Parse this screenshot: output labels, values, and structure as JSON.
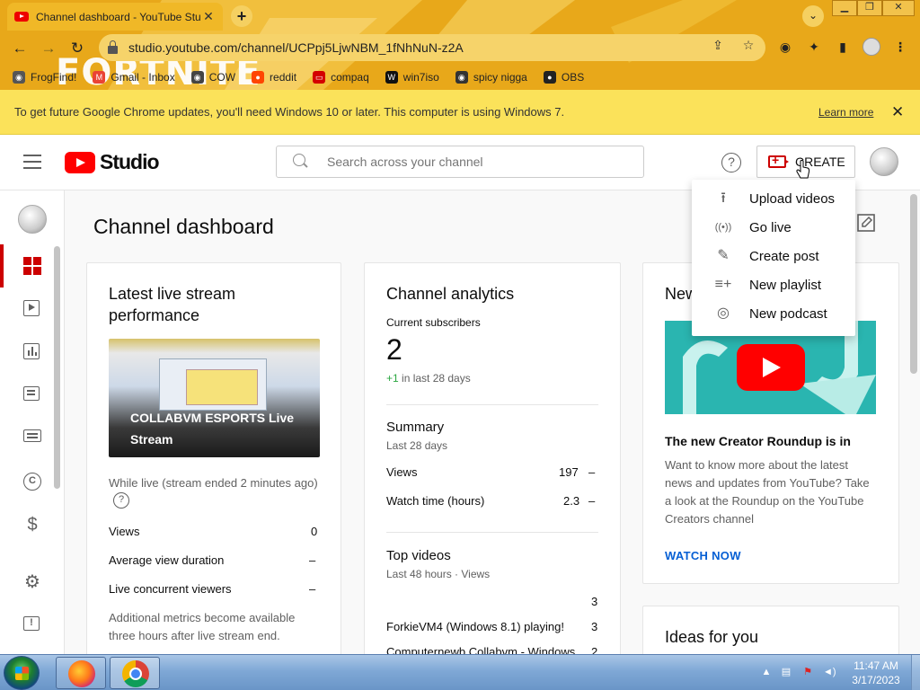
{
  "browser": {
    "tab_title": "Channel dashboard - YouTube Studio",
    "tab_close": "✕",
    "new_tab": "+",
    "url": "studio.youtube.com/channel/UCPpj5LjwNBM_1fNhNuN-z2A",
    "art_text": "FORTNITE",
    "bookmarks": [
      {
        "label": "FrogFind!",
        "color": "#555555",
        "glyph": "◉"
      },
      {
        "label": "Gmail - Inbox",
        "color": "#ea4335",
        "glyph": "M"
      },
      {
        "label": "COW",
        "color": "#444444",
        "glyph": "◉"
      },
      {
        "label": "reddit",
        "color": "#ff4500",
        "glyph": "●"
      },
      {
        "label": "compaq",
        "color": "#d40000",
        "glyph": "▭"
      },
      {
        "label": "win7iso",
        "color": "#111111",
        "glyph": "W"
      },
      {
        "label": "spicy nigga",
        "color": "#333333",
        "glyph": "◉"
      },
      {
        "label": "OBS",
        "color": "#222222",
        "glyph": "●"
      }
    ]
  },
  "infobar": {
    "message": "To get future Google Chrome updates, you'll need Windows 10 or later. This computer is using Windows 7.",
    "learn_more": "Learn more",
    "close": "✕"
  },
  "header": {
    "logo_text": "Studio",
    "search_placeholder": "Search across your channel",
    "help": "?",
    "create_label": "CREATE"
  },
  "create_menu": {
    "items": [
      {
        "label": "Upload videos",
        "icon": "upload-icon",
        "glyph": "⭱"
      },
      {
        "label": "Go live",
        "icon": "go-live-icon",
        "glyph": "((•))"
      },
      {
        "label": "Create post",
        "icon": "create-post-icon",
        "glyph": "✎"
      },
      {
        "label": "New playlist",
        "icon": "new-playlist-icon",
        "glyph": "≡+"
      },
      {
        "label": "New podcast",
        "icon": "new-podcast-icon",
        "glyph": "◎"
      }
    ]
  },
  "main": {
    "page_title": "Channel dashboard",
    "live_card": {
      "title_line1": "Latest live stream",
      "title_line2": "performance",
      "thumb_title": "COLLABVM ESPORTS Live Stream",
      "status": "While live (stream ended 2 minutes ago)",
      "help": "?",
      "rows": [
        {
          "label": "Views",
          "value": "0"
        },
        {
          "label": "Average view duration",
          "value": "–"
        },
        {
          "label": "Live concurrent viewers",
          "value": "–"
        }
      ],
      "note_line1": "Additional metrics become available",
      "note_line2": "three hours after live stream end."
    },
    "analytics_card": {
      "title": "Channel analytics",
      "subs_label": "Current subscribers",
      "subs_value": "2",
      "subs_delta": "+1",
      "subs_delta_suffix": " in last 28 days",
      "summary_title": "Summary",
      "summary_period": "Last 28 days",
      "summary_rows": [
        {
          "label": "Views",
          "value": "197",
          "trend": "–"
        },
        {
          "label": "Watch time (hours)",
          "value": "2.3",
          "trend": "–"
        }
      ],
      "top_title": "Top videos",
      "top_period": "Last 48 hours · Views",
      "top_rows": [
        {
          "label": "",
          "value": "3"
        },
        {
          "label": "ForkieVM4 (Windows 8.1) playing!",
          "value": "3"
        },
        {
          "label": "Computernewb Collabvm - Windows",
          "value": "2"
        }
      ]
    },
    "news_card": {
      "title": "New",
      "headline": "The new Creator Roundup is in",
      "body_line1": "Want to know more about the latest",
      "body_line2": "news and updates from YouTube? Take",
      "body_line3": "a look at the Roundup on the YouTube",
      "body_line4": "Creators channel",
      "cta": "WATCH NOW"
    },
    "ideas_card": {
      "title": "Ideas for you"
    }
  },
  "taskbar": {
    "time": "11:47 AM",
    "date": "3/17/2023"
  }
}
